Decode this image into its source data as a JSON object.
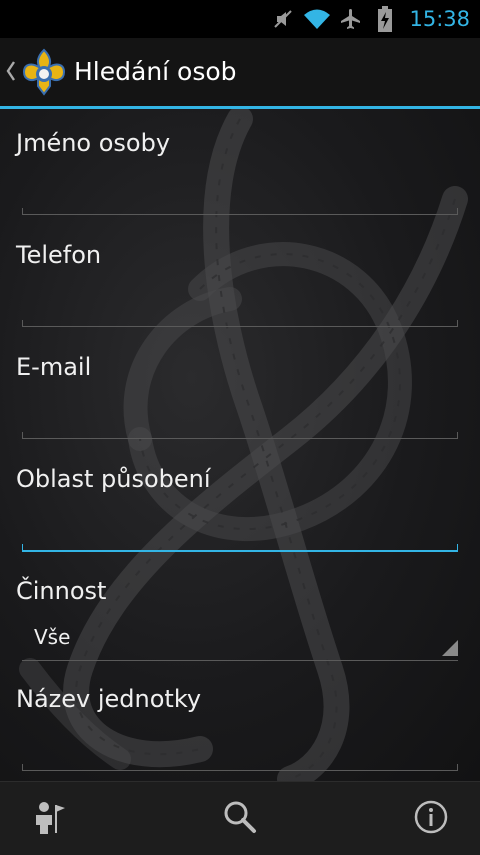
{
  "status_bar": {
    "time": "15:38",
    "icons": [
      "mute-icon",
      "wifi-icon",
      "airplane-icon",
      "battery-charging-icon"
    ],
    "accent_color": "#33b5e5"
  },
  "action_bar": {
    "title": "Hledání osob",
    "logo_icon": "scout-lily-logo"
  },
  "form": {
    "name_label": "Jméno osoby",
    "name_value": "",
    "phone_label": "Telefon",
    "phone_value": "",
    "email_label": "E-mail",
    "email_value": "",
    "area_label": "Oblast působení",
    "area_value": "",
    "activity_label": "Činnost",
    "activity_selected": "Vše",
    "unit_label": "Název jednotky",
    "unit_value": ""
  },
  "bottom_bar": {
    "icons": [
      "scout-person-icon",
      "search-icon",
      "info-icon"
    ]
  }
}
